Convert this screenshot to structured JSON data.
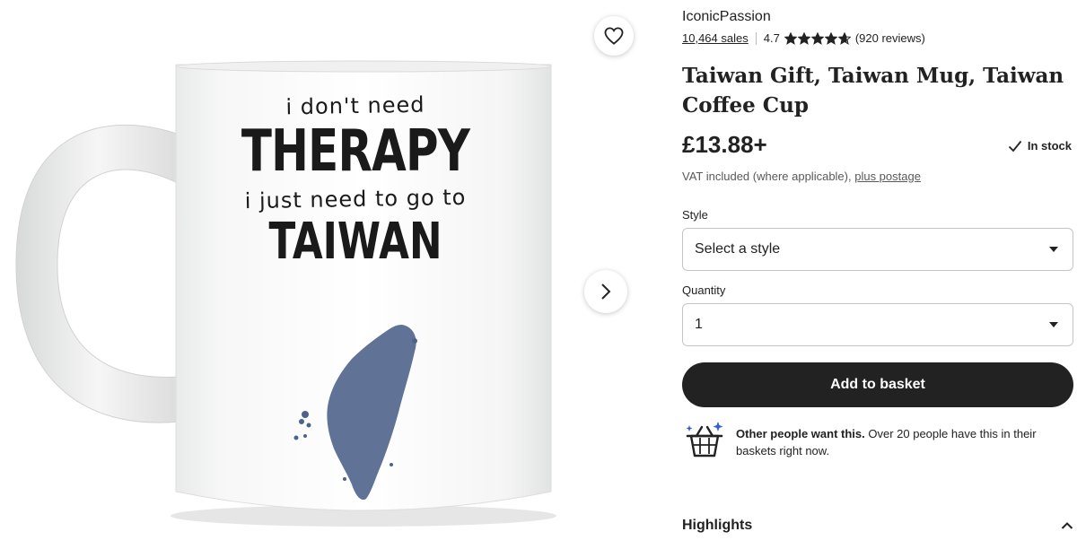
{
  "mug": {
    "line1": "i don't need",
    "line2": "THERAPY",
    "line3": "i just need to go to",
    "line4": "TAIWAN"
  },
  "shop": {
    "name": "IconicPassion",
    "sales": "10,464 sales",
    "rating": "4.7",
    "stars": 4.7,
    "reviews": "(920 reviews)"
  },
  "product": {
    "title": "Taiwan Gift, Taiwan Mug, Taiwan Coffee Cup",
    "price": "£13.88+",
    "stock": "In stock",
    "vat_text": "VAT included (where applicable), ",
    "vat_link": "plus postage"
  },
  "style_field": {
    "label": "Style",
    "value": "Select a style"
  },
  "quantity_field": {
    "label": "Quantity",
    "value": "1"
  },
  "actions": {
    "add_to_basket": "Add to basket"
  },
  "social": {
    "bold": "Other people want this.",
    "text": " Over 20 people have this in their baskets right now."
  },
  "highlights": {
    "label": "Highlights"
  },
  "icons": {
    "favorite": "heart-icon",
    "next": "chevron-right-icon",
    "stock": "check-icon",
    "select": "caret-down-icon",
    "social": "basket-sparkle-icon",
    "highlights": "chevron-up-icon"
  },
  "colors": {
    "button_dark": "#222222",
    "star": "#222222",
    "taiwan_map": "#4f6389"
  }
}
